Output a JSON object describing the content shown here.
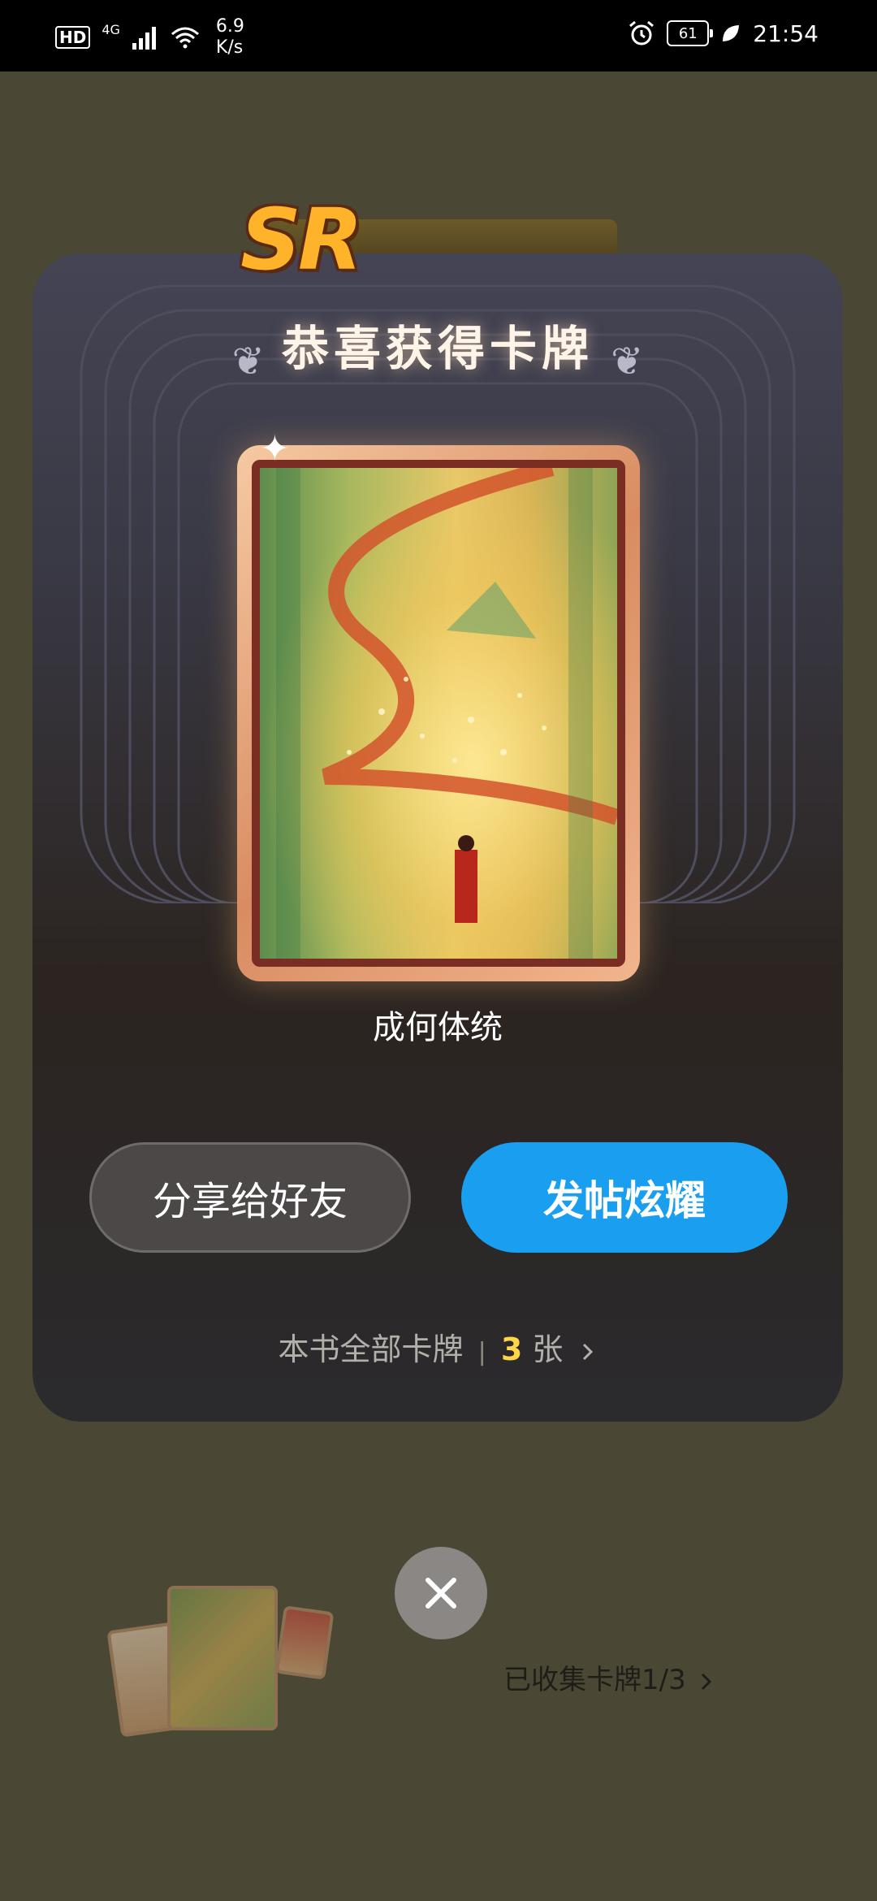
{
  "status_bar": {
    "hd": "HD",
    "network": "4G",
    "speed_value": "6.9",
    "speed_unit": "K/s",
    "battery": "61",
    "time": "21:54"
  },
  "modal": {
    "title": "恭喜获得卡牌",
    "rarity": "SR",
    "card_name": "成何体统",
    "share_label": "分享给好友",
    "post_label": "发帖炫耀",
    "all_cards_prefix": "本书全部卡牌",
    "all_cards_count": "3",
    "all_cards_unit": "张"
  },
  "collection": {
    "label": "已收集卡牌1/3"
  },
  "icons": {
    "close": "close-icon",
    "chevron": "chevron-right-icon",
    "alarm": "alarm-icon",
    "wifi": "wifi-icon",
    "signal": "signal-icon",
    "leaf": "leaf-icon"
  }
}
